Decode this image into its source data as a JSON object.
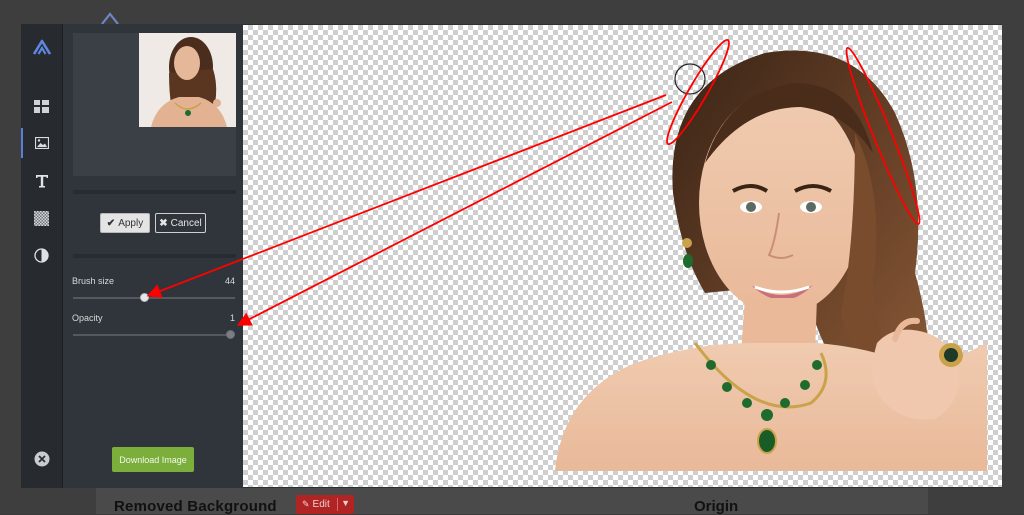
{
  "background_page": {
    "left_title": "Removed Background",
    "edit_label": "Edit",
    "right_title": "Origin"
  },
  "sidebar_icons": [
    {
      "name": "logo-icon"
    },
    {
      "name": "layout-icon"
    },
    {
      "name": "image-icon",
      "active": true
    },
    {
      "name": "text-icon"
    },
    {
      "name": "pattern-icon"
    },
    {
      "name": "contrast-icon"
    },
    {
      "name": "close-icon"
    }
  ],
  "panel": {
    "apply_label": "Apply",
    "cancel_label": "Cancel",
    "brush_size": {
      "label": "Brush size",
      "value": "44",
      "fraction": 0.44
    },
    "opacity": {
      "label": "Opacity",
      "value": "1",
      "fraction": 1.0
    },
    "download_label": "Download Image"
  },
  "colors": {
    "accent": "#5a7fd8",
    "download": "#7cae3c",
    "annotation": "#ff0000"
  }
}
